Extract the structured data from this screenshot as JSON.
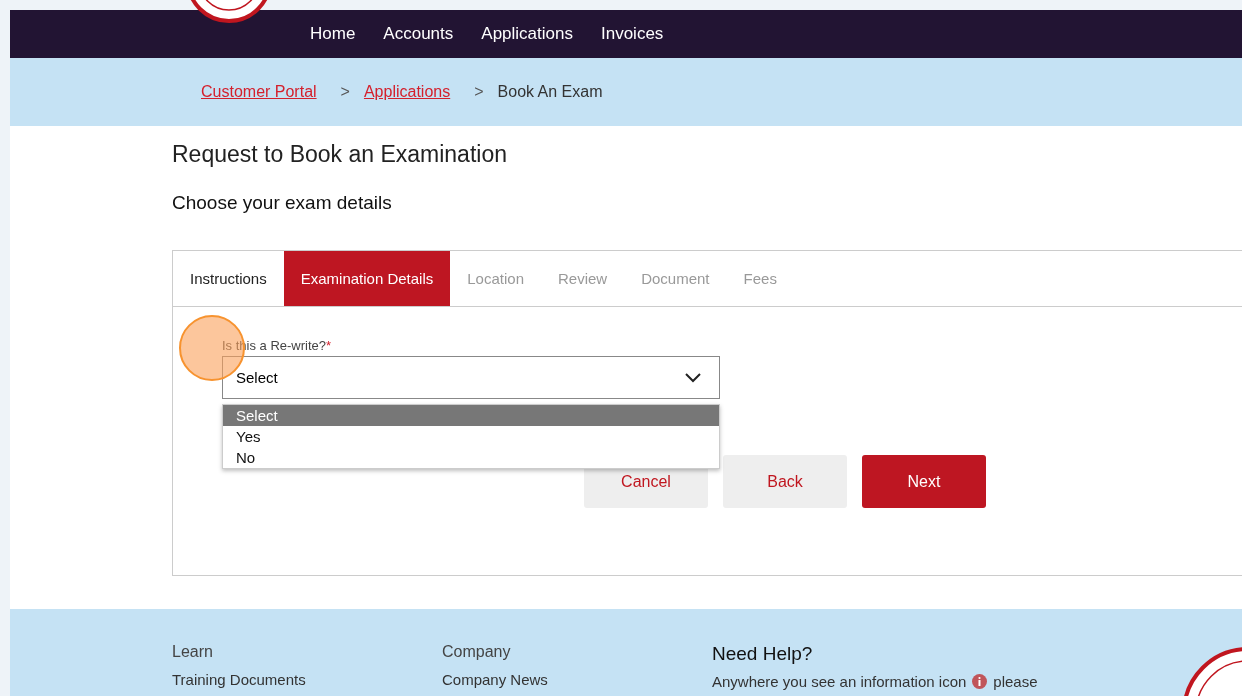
{
  "nav": {
    "items": [
      "Home",
      "Accounts",
      "Applications",
      "Invoices"
    ]
  },
  "breadcrumb": {
    "links": [
      "Customer Portal",
      "Applications"
    ],
    "separators": [
      ">",
      ">"
    ],
    "current": "Book An Exam"
  },
  "title": "Request to Book an Examination",
  "subtitle": "Choose your exam details",
  "tabs": [
    {
      "label": "Instructions",
      "selected": false,
      "disabled": false
    },
    {
      "label": "Examination Details",
      "selected": true,
      "disabled": false
    },
    {
      "label": "Location",
      "selected": false,
      "disabled": true
    },
    {
      "label": "Review",
      "selected": false,
      "disabled": true
    },
    {
      "label": "Document",
      "selected": false,
      "disabled": true
    },
    {
      "label": "Fees",
      "selected": false,
      "disabled": true
    }
  ],
  "question": {
    "label": "Is this a Re-write?",
    "required_mark": "*",
    "value": "Select",
    "expanded": true,
    "options": [
      {
        "label": "Select",
        "selected": true
      },
      {
        "label": "Yes",
        "selected": false
      },
      {
        "label": "No",
        "selected": false
      }
    ]
  },
  "buttons": [
    {
      "label": "Cancel",
      "kind": "secondary"
    },
    {
      "label": "Back",
      "kind": "secondary"
    },
    {
      "label": "Next",
      "kind": "primary"
    }
  ],
  "footer": {
    "columns": [
      {
        "heading": "Learn",
        "links": [
          "Training Documents"
        ]
      },
      {
        "heading": "Company",
        "links": [
          "Company News"
        ]
      }
    ],
    "help": {
      "heading": "Need Help?",
      "text_before": "Anywhere you see an information icon",
      "text_after": "please"
    }
  }
}
